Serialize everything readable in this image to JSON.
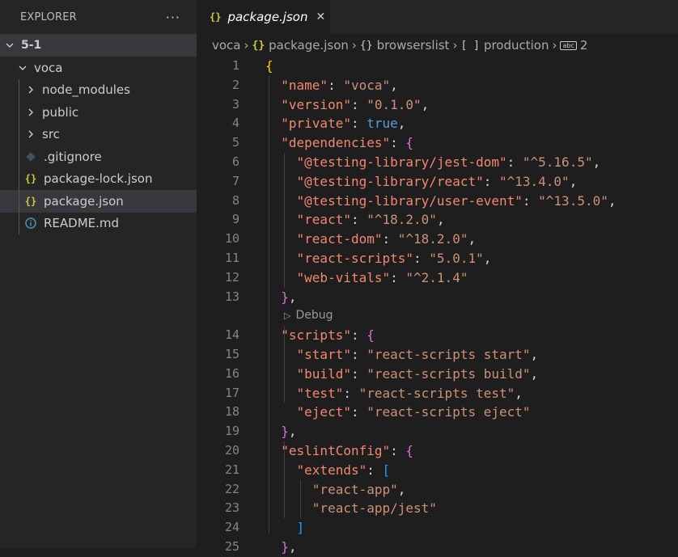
{
  "sidebar": {
    "title": "EXPLORER",
    "more_label": "···",
    "root": "5-1",
    "items": [
      {
        "label": "voca",
        "kind": "folder-open"
      },
      {
        "label": "node_modules",
        "kind": "folder"
      },
      {
        "label": "public",
        "kind": "folder"
      },
      {
        "label": "src",
        "kind": "folder"
      },
      {
        "label": ".gitignore",
        "kind": "git"
      },
      {
        "label": "package-lock.json",
        "kind": "json"
      },
      {
        "label": "package.json",
        "kind": "json",
        "selected": true
      },
      {
        "label": "README.md",
        "kind": "info"
      }
    ]
  },
  "tab": {
    "title": "package.json",
    "close": "✕",
    "icon": "{}"
  },
  "breadcrumb": {
    "items": [
      "voca",
      "package.json",
      "browserslist",
      "production",
      "2"
    ],
    "icons": [
      "",
      "{}",
      "{}",
      "[ ]",
      "abc"
    ]
  },
  "codelens": {
    "label": "Debug"
  },
  "line_numbers": [
    "1",
    "2",
    "3",
    "4",
    "5",
    "6",
    "7",
    "8",
    "9",
    "10",
    "11",
    "12",
    "13",
    "14",
    "15",
    "16",
    "17",
    "18",
    "19",
    "20",
    "21",
    "22",
    "23",
    "24",
    "25"
  ],
  "code": {
    "name_key": "\"name\"",
    "name_val": "\"voca\"",
    "version_key": "\"version\"",
    "version_val": "\"0.1.0\"",
    "private_key": "\"private\"",
    "private_val": "true",
    "deps_key": "\"dependencies\"",
    "deps": [
      {
        "k": "\"@testing-library/jest-dom\"",
        "v": "\"^5.16.5\""
      },
      {
        "k": "\"@testing-library/react\"",
        "v": "\"^13.4.0\""
      },
      {
        "k": "\"@testing-library/user-event\"",
        "v": "\"^13.5.0\""
      },
      {
        "k": "\"react\"",
        "v": "\"^18.2.0\""
      },
      {
        "k": "\"react-dom\"",
        "v": "\"^18.2.0\""
      },
      {
        "k": "\"react-scripts\"",
        "v": "\"5.0.1\""
      },
      {
        "k": "\"web-vitals\"",
        "v": "\"^2.1.4\""
      }
    ],
    "scripts_key": "\"scripts\"",
    "scripts": [
      {
        "k": "\"start\"",
        "v": "\"react-scripts start\""
      },
      {
        "k": "\"build\"",
        "v": "\"react-scripts build\""
      },
      {
        "k": "\"test\"",
        "v": "\"react-scripts test\""
      },
      {
        "k": "\"eject\"",
        "v": "\"react-scripts eject\""
      }
    ],
    "eslint_key": "\"eslintConfig\"",
    "extends_key": "\"extends\"",
    "extends": [
      "\"react-app\"",
      "\"react-app/jest\""
    ]
  }
}
